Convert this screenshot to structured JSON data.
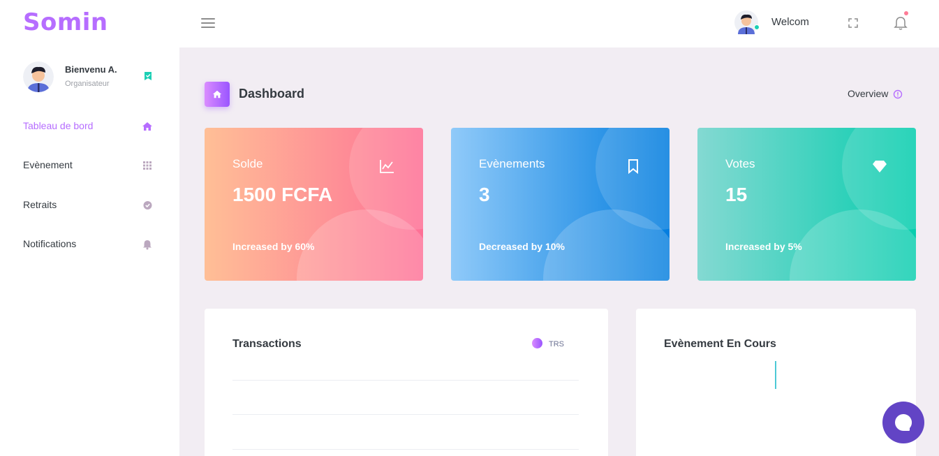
{
  "brand": "Somin",
  "topbar": {
    "welcome": "Welcom"
  },
  "sidebar": {
    "profile": {
      "name": "Bienvenu A.",
      "role": "Organisateur"
    },
    "items": [
      {
        "label": "Tableau de bord",
        "icon": "home-icon",
        "active": true
      },
      {
        "label": "Evènement",
        "icon": "grid-icon",
        "active": false
      },
      {
        "label": "Retraits",
        "icon": "check-circle-icon",
        "active": false
      },
      {
        "label": "Notifications",
        "icon": "bell-icon",
        "active": false
      }
    ]
  },
  "page": {
    "title": "Dashboard",
    "overview": "Overview"
  },
  "cards": [
    {
      "title": "Solde",
      "value": "1500 FCFA",
      "footer": "Increased by 60%",
      "icon": "chart-line-icon"
    },
    {
      "title": "Evènements",
      "value": "3",
      "footer": "Decreased by 10%",
      "icon": "bookmark-icon"
    },
    {
      "title": "Votes",
      "value": "15",
      "footer": "Increased by 5%",
      "icon": "diamond-icon"
    }
  ],
  "transactions": {
    "title": "Transactions",
    "legend": "TRS"
  },
  "events_panel": {
    "title": "Evènement En Cours"
  },
  "colors": {
    "accent": "#b66dff",
    "online": "#1bcfb4",
    "chat": "#6244c5"
  }
}
